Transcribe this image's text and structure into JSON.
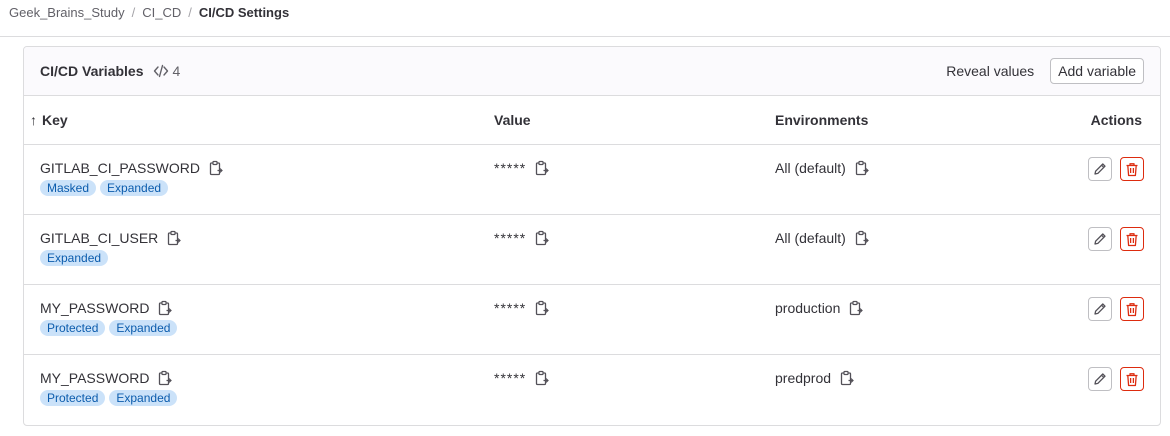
{
  "breadcrumb": {
    "items": [
      "Geek_Brains_Study",
      "CI_CD"
    ],
    "current": "CI/CD Settings",
    "separator": "/"
  },
  "card": {
    "title": "CI/CD Variables",
    "count": "4",
    "reveal_label": "Reveal values",
    "add_label": "Add variable"
  },
  "table": {
    "headers": {
      "sort_arrow": "↑",
      "key": "Key",
      "value": "Value",
      "environments": "Environments",
      "actions": "Actions"
    },
    "rows": [
      {
        "key": "GITLAB_CI_PASSWORD",
        "value": "*****",
        "environment": "All (default)",
        "badges": [
          "Masked",
          "Expanded"
        ]
      },
      {
        "key": "GITLAB_CI_USER",
        "value": "*****",
        "environment": "All (default)",
        "badges": [
          "Expanded"
        ]
      },
      {
        "key": "MY_PASSWORD",
        "value": "*****",
        "environment": "production",
        "badges": [
          "Protected",
          "Expanded"
        ]
      },
      {
        "key": "MY_PASSWORD",
        "value": "*****",
        "environment": "predprod",
        "badges": [
          "Protected",
          "Expanded"
        ]
      }
    ]
  },
  "colors": {
    "badge_bg": "#cbe2f9",
    "badge_text": "#0b5cad",
    "danger": "#dd2b0e"
  }
}
